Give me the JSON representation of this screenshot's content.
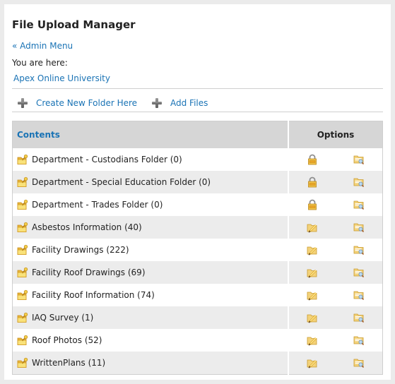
{
  "page": {
    "title": "File Upload Manager",
    "admin_link": "« Admin Menu",
    "here_label": "You are here:",
    "breadcrumb": "Apex Online University"
  },
  "toolbar": {
    "create_folder": "Create New Folder Here",
    "add_files": "Add Files"
  },
  "table": {
    "header_contents": "Contents",
    "header_options": "Options",
    "rows": [
      {
        "name": "Department - Custodians Folder (0)",
        "locked": true
      },
      {
        "name": "Department - Special Education Folder (0)",
        "locked": true
      },
      {
        "name": "Department - Trades Folder (0)",
        "locked": true
      },
      {
        "name": "Asbestos Information (40)",
        "locked": false
      },
      {
        "name": "Facility Drawings (222)",
        "locked": false
      },
      {
        "name": "Facility Roof Drawings (69)",
        "locked": false
      },
      {
        "name": "Facility Roof Information (74)",
        "locked": false
      },
      {
        "name": "IAQ Survey (1)",
        "locked": false
      },
      {
        "name": "Roof Photos (52)",
        "locked": false
      },
      {
        "name": "WrittenPlans (11)",
        "locked": false
      }
    ]
  },
  "colors": {
    "link": "#1a73b5",
    "header_bg": "#d6d6d6",
    "alt_row": "#ececec"
  }
}
